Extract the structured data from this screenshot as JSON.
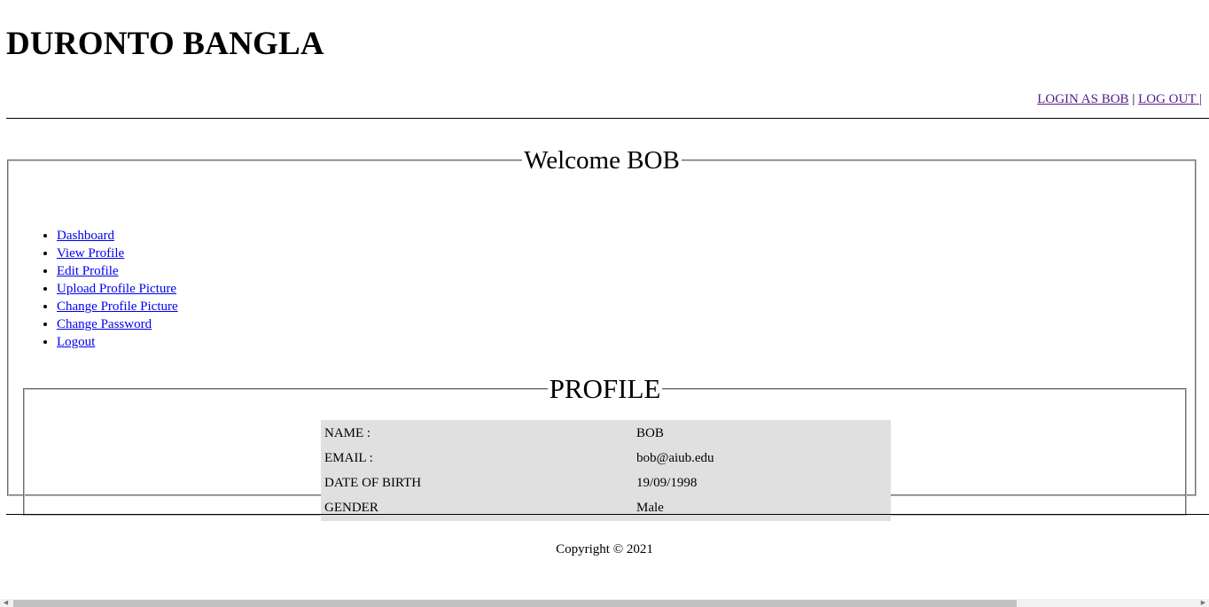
{
  "header": {
    "site_title": "DURONTO BANGLA",
    "login_link": "LOGIN AS BOB",
    "separator_1": "|",
    "logout_link": "LOG OUT",
    "separator_2": "|"
  },
  "welcome": {
    "legend": "Welcome BOB",
    "menu": [
      {
        "label": "Dashboard"
      },
      {
        "label": "View Profile"
      },
      {
        "label": "Edit Profile"
      },
      {
        "label": "Upload Profile Picture"
      },
      {
        "label": "Change Profile Picture"
      },
      {
        "label": "Change Password"
      },
      {
        "label": "Logout"
      }
    ]
  },
  "profile": {
    "legend": "PROFILE",
    "rows": [
      {
        "key": "NAME :",
        "value": "BOB"
      },
      {
        "key": "EMAIL :",
        "value": "bob@aiub.edu"
      },
      {
        "key": "DATE OF BIRTH",
        "value": "19/09/1998"
      },
      {
        "key": "GENDER",
        "value": "Male"
      }
    ]
  },
  "footer": {
    "copyright": "Copyright © 2021"
  },
  "colors": {
    "link": "#0000ee",
    "visited_link": "#551a8b",
    "profile_table_bg": "#e0e0e0"
  }
}
